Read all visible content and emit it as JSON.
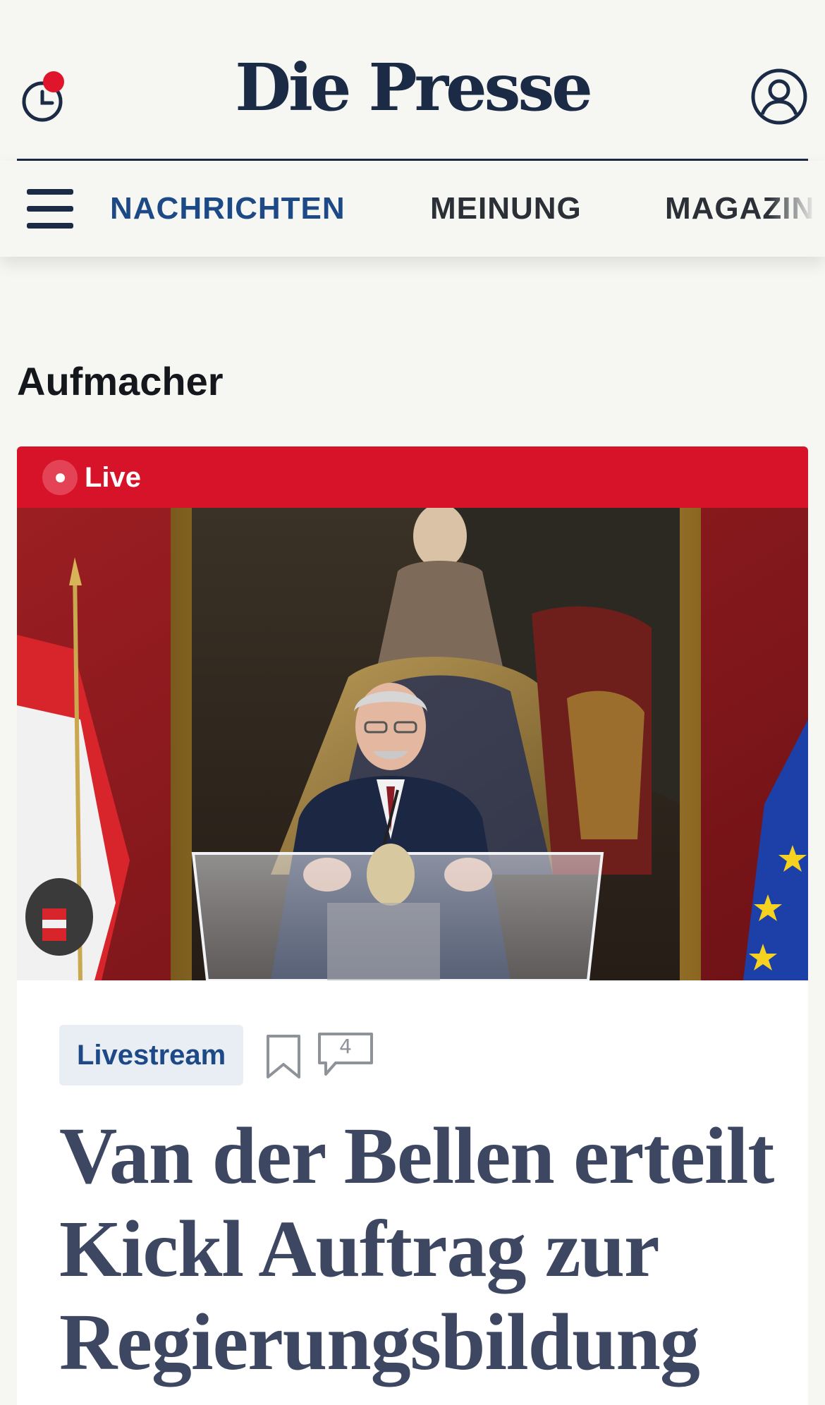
{
  "header": {
    "logo": "Die Presse",
    "history_icon": "history-clock-icon",
    "notification_color": "#e0152c",
    "account_icon": "user-account-icon",
    "brand_color": "#1b2a45"
  },
  "nav": {
    "menu_icon": "hamburger-menu-icon",
    "items": [
      {
        "label": "NACHRICHTEN",
        "active": true
      },
      {
        "label": "MEINUNG",
        "active": false
      },
      {
        "label": "MAGAZIN",
        "active": false
      }
    ],
    "active_color": "#1d4a86"
  },
  "section": {
    "title": "Aufmacher"
  },
  "article": {
    "live_label": "Live",
    "live_color": "#d7132a",
    "tag": "Livestream",
    "bookmark_icon": "bookmark-icon",
    "comment_icon": "comment-bubble-icon",
    "comment_count": "4",
    "headline": "Van der Bellen erteilt Kickl Auftrag zur Regierungsbildung"
  }
}
